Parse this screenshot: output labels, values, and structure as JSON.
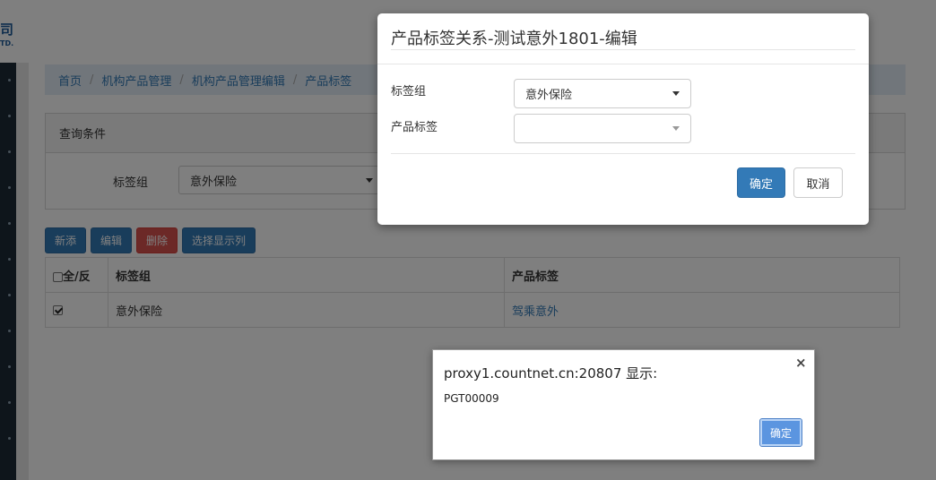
{
  "logo": {
    "text": "司",
    "sub": "TD."
  },
  "breadcrumb": {
    "items": [
      "首页",
      "机构产品管理",
      "机构产品管理编辑",
      "产品标签"
    ],
    "separator": "/"
  },
  "query": {
    "heading": "查询条件",
    "field_label": "标签组",
    "field_value": "意外保险"
  },
  "toolbar": {
    "add_label": "新添",
    "edit_label": "编辑",
    "delete_label": "删除",
    "columns_label": "选择显示列"
  },
  "table": {
    "headers": [
      "全/反",
      "标签组",
      "产品标签"
    ],
    "rows": [
      {
        "checked": true,
        "group": "意外保险",
        "tag": "驾乘意外"
      }
    ]
  },
  "modal": {
    "title": "产品标签关系-测试意外1801-编辑",
    "group_label": "标签组",
    "group_value": "意外保险",
    "tag_label": "产品标签",
    "tag_value": "",
    "ok_label": "确定",
    "cancel_label": "取消"
  },
  "alert": {
    "title": "proxy1.countnet.cn:20807 显示:",
    "message": "PGT00009",
    "ok_label": "确定",
    "close_glyph": "×"
  },
  "colors": {
    "primary": "#337ab7",
    "danger": "#d9534f",
    "nav_bg": "#1d2b36",
    "breadcrumb_bg": "#e3ecf6"
  }
}
